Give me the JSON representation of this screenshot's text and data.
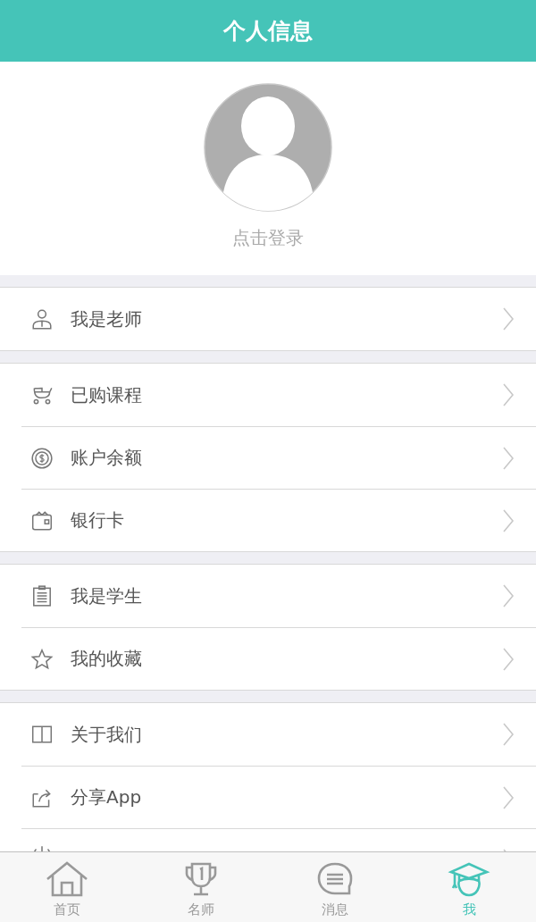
{
  "header": {
    "title": "个人信息"
  },
  "profile": {
    "login_label": "点击登录"
  },
  "groups": [
    {
      "items": [
        {
          "kind": "teacher",
          "label": "我是老师"
        }
      ]
    },
    {
      "items": [
        {
          "kind": "stroller",
          "label": "已购课程"
        },
        {
          "kind": "coin",
          "label": "账户余额"
        },
        {
          "kind": "wallet",
          "label": "银行卡"
        }
      ]
    },
    {
      "items": [
        {
          "kind": "clipboard",
          "label": "我是学生"
        },
        {
          "kind": "star",
          "label": "我的收藏"
        }
      ]
    },
    {
      "items": [
        {
          "kind": "book",
          "label": "关于我们"
        },
        {
          "kind": "share",
          "label": "分享App"
        },
        {
          "kind": "logout"
        }
      ]
    }
  ],
  "tab_bar": [
    {
      "kind": "home",
      "label": "首页",
      "selected": false
    },
    {
      "kind": "trophy",
      "label": "名师",
      "selected": false
    },
    {
      "kind": "message",
      "label": "消息",
      "selected": false
    },
    {
      "kind": "graduate",
      "label": "我",
      "selected": true
    }
  ]
}
